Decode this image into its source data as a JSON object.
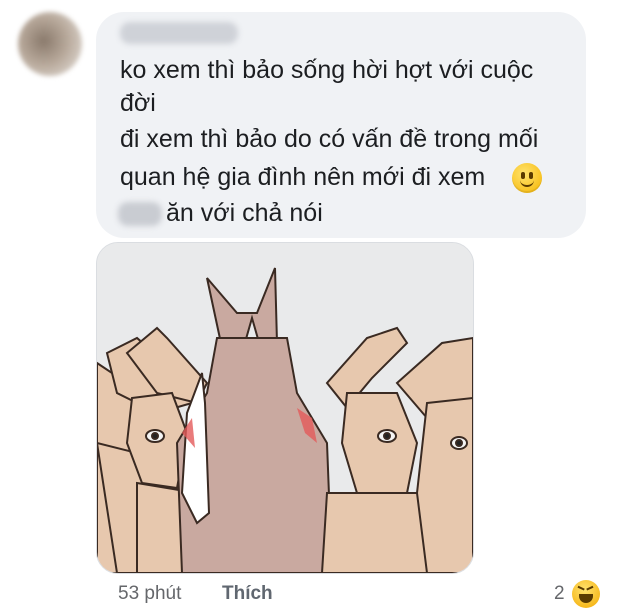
{
  "comment": {
    "lines": [
      "ko xem thì bảo sống hời hợt với cuộc",
      "đời",
      "đi xem thì bảo do có vấn đề trong mối",
      "quan hệ gia đình nên mới đi xem",
      "ăn với chả nói"
    ],
    "emoji": "slightly-smiling-face"
  },
  "footer": {
    "time": "53 phút",
    "like_label": "Thích",
    "reaction_count": "2",
    "reaction_icon": "haha"
  },
  "colors": {
    "bubble": "#f0f2f5",
    "text": "#1c1e21",
    "meta": "#65676b",
    "figure_main": "#c9a9a0",
    "figure_side": "#e7c8ae"
  }
}
